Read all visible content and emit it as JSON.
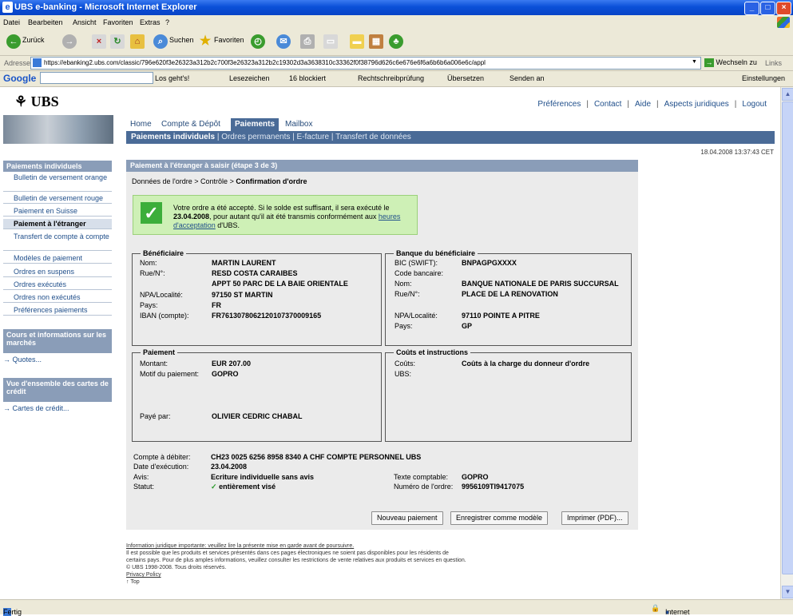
{
  "window": {
    "title": "UBS e-banking - Microsoft Internet Explorer"
  },
  "menu": [
    "Datei",
    "Bearbeiten",
    "Ansicht",
    "Favoriten",
    "Extras",
    "?"
  ],
  "toolbar": {
    "back": "Zurück",
    "search": "Suchen",
    "favorites": "Favoriten"
  },
  "address": {
    "label": "Adresse",
    "url": "https://ebanking2.ubs.com/classic/796e620f3e26323a312b2c700f3e26323a312b2c19302d3a3638310c33362f0f38796d626c6e676e6f6a6b6b6a006e6c/appl",
    "go": "Wechseln zu",
    "links": "Links"
  },
  "googlebar": {
    "logo": "Google",
    "go": "Los geht's!",
    "bookmarks": "Lesezeichen",
    "blocked": "16 blockiert",
    "spell": "Rechtschreibprüfung",
    "translate": "Übersetzen",
    "send": "Senden an",
    "settings": "Einstellungen"
  },
  "page": {
    "logo": "UBS",
    "toplinks": [
      "Préférences",
      "Contact",
      "Aide",
      "Aspects juridiques",
      "Logout"
    ],
    "tabs": [
      "Home",
      "Compte & Dépôt",
      "Paiements",
      "Mailbox"
    ],
    "subnav": [
      "Paiements individuels",
      "Ordres permanents",
      "E-facture",
      "Transfert de données"
    ],
    "datetime": "18.04.2008 13:37:43 CET"
  },
  "sidebar": {
    "header1": "Paiements individuels",
    "items": [
      "Bulletin de versement orange",
      "Bulletin de versement rouge",
      "Paiement en Suisse",
      "Paiement à l'étranger",
      "Transfert de compte à compte",
      "Modèles de paiement",
      "Ordres en suspens",
      "Ordres exécutés",
      "Ordres non exécutés",
      "Préférences paiements"
    ],
    "header2": "Cours et informations sur les marchés",
    "link2": "Quotes...",
    "header3": "Vue d'ensemble des cartes de crédit",
    "link3": "Cartes de crédit..."
  },
  "main": {
    "header": "Paiement à l'étranger à saisir  (étape 3 de 3)",
    "crumb1": "Données de l'ordre",
    "crumb2": "Contrôle",
    "crumb3": "Confirmation d'ordre",
    "ok_text1": "Votre ordre a été accepté. Si le solde est suffisant, il sera exécuté le",
    "ok_date": "23.04.2008",
    "ok_text2": ", pour autant qu'il ait été transmis conformément aux",
    "ok_link": "heures d'acceptation",
    "ok_text3": " d'UBS.",
    "beneficiary": {
      "legend": "Bénéficiaire",
      "labels": [
        "Nom:",
        "Rue/N°:",
        "",
        "NPA/Localité:",
        "Pays:",
        "IBAN (compte):"
      ],
      "values": [
        "MARTIN LAURENT",
        "RESD COSTA CARAIBES",
        "APPT 50 PARC DE LA BAIE ORIENTALE",
        "97150 ST MARTIN",
        "FR",
        "FR7613078062120107370009165"
      ]
    },
    "bank": {
      "legend": "Banque du bénéficiaire",
      "labels": [
        "BIC (SWIFT):",
        "Code bancaire:",
        "Nom:",
        "Rue/N°:",
        "",
        "NPA/Localité:",
        "Pays:"
      ],
      "values": [
        "BNPAGPGXXXX",
        "",
        "BANQUE NATIONALE DE PARIS SUCCURSAL",
        "PLACE DE LA RENOVATION",
        "",
        "97110 POINTE A PITRE",
        "GP"
      ]
    },
    "payment": {
      "legend": "Paiement",
      "labels": [
        "Montant:",
        "Motif du paiement:",
        "Payé par:"
      ],
      "values": [
        "EUR  207.00",
        "GOPRO",
        "OLIVIER CEDRIC CHABAL"
      ]
    },
    "costs": {
      "legend": "Coûts et instructions",
      "labels": [
        "Coûts:",
        "UBS:"
      ],
      "values": [
        "Coûts à la charge du donneur d'ordre",
        ""
      ]
    },
    "summary": {
      "debit_label": "Compte à débiter:",
      "debit_value": "CH23 0025 6256 8958 8340 A  CHF  COMPTE PERSONNEL UBS",
      "exec_label": "Date d'exécution:",
      "exec_value": "23.04.2008",
      "avis_label": "Avis:",
      "avis_value": "Ecriture individuelle sans avis",
      "status_label": "Statut:",
      "status_value": "entièrement visé",
      "text_label": "Texte comptable:",
      "text_value": "GOPRO",
      "order_label": "Numéro de l'ordre:",
      "order_value": "9956109TI9417075"
    },
    "buttons": [
      "Nouveau paiement",
      "Enregistrer comme modèle",
      "Imprimer (PDF)..."
    ]
  },
  "footer": {
    "line1": "Information juridique importante: veuillez lire la présente mise en garde avant de poursuivre.",
    "line2": "Il est possible que les produits et services présentés dans ces pages électroniques ne soient pas disponibles pour les résidents de certains pays. Pour de plus amples informations, veuillez consulter les restrictions de vente relatives aux produits et services en question.",
    "line3": "© UBS 1998-2008. Tous droits réservés.",
    "privacy": "Privacy Policy",
    "top": "Top"
  },
  "status": {
    "left": "Fertig",
    "zone": "Internet"
  }
}
